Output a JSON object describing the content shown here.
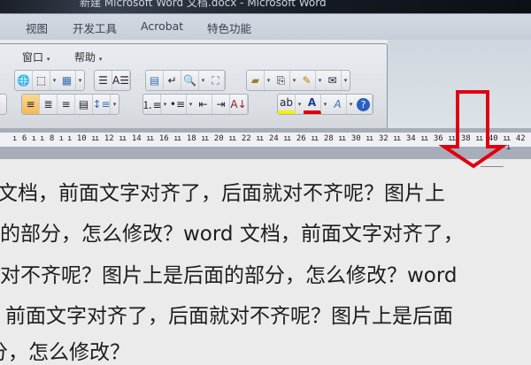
{
  "window": {
    "title": "新建 Microsoft Word 文档.docx - Microsoft Word"
  },
  "ribbon_tabs": [
    "视图",
    "开发工具",
    "Acrobat",
    "特色功能"
  ],
  "menus": [
    {
      "label": "窗口"
    },
    {
      "label": "帮助"
    }
  ],
  "toolbar": {
    "row1": [
      "hyperlink-icon",
      "borders-icon",
      "table-icon",
      "columns-icon",
      "text-direction-icon",
      "document-map-icon",
      "show-formatting-icon",
      "zoom-icon",
      "full-screen-icon",
      "open-folder-icon",
      "copy-format-icon",
      "edit-icon",
      "envelope-icon"
    ],
    "row2": [
      "align-left-icon",
      "justify-icon",
      "center-icon",
      "distributed-icon",
      "line-spacing-icon",
      "numbering-icon",
      "bullets-icon",
      "decrease-indent-icon",
      "increase-indent-icon",
      "sort-icon",
      "highlight-icon",
      "font-color-icon",
      "text-effects-icon",
      "help-icon"
    ],
    "active": "align-left-icon",
    "highlight_color": "#f2f200",
    "font_color": "#e00000"
  },
  "ruler": {
    "numbers": [
      "6",
      "8",
      "10",
      "12",
      "14",
      "16",
      "18",
      "20",
      "22",
      "24",
      "26",
      "28",
      "30",
      "32",
      "34",
      "36",
      "38",
      "40",
      "42"
    ]
  },
  "document": {
    "lines": [
      "文档，前面文字对齐了，后面就对不齐呢？图片上",
      "面的部分，怎么修改？word 文档，前面文字对齐了，",
      "就对不齐呢？图片上是后面的部分，怎么修改？word",
      "，前面文字对齐了，后面就对不齐呢？图片上是后面",
      "分，怎么修改？"
    ]
  },
  "annotation": {
    "color": "#e00010"
  }
}
